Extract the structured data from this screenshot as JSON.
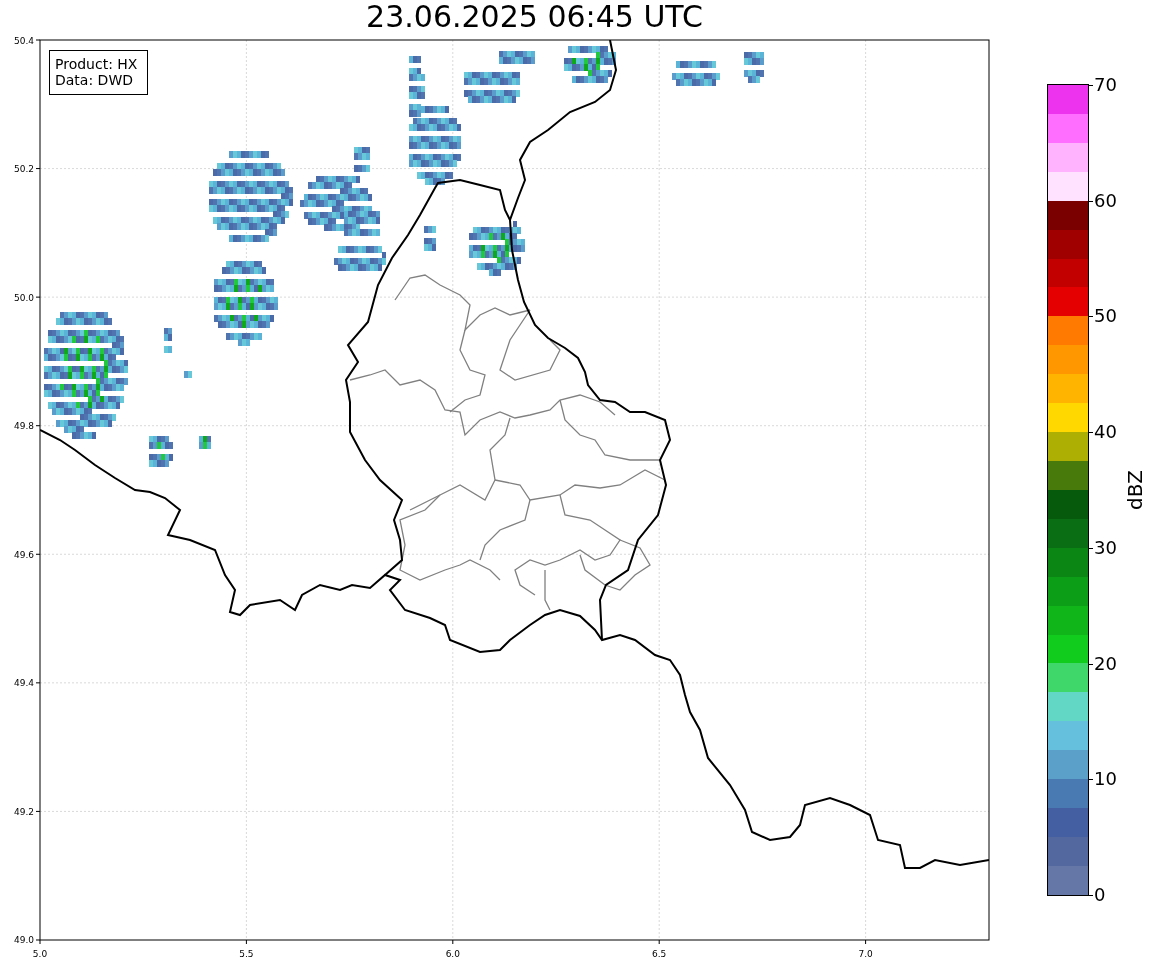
{
  "title": "23.06.2025 06:45 UTC",
  "map": {
    "info_box": [
      "Product: HX",
      "Data: DWD"
    ],
    "x_ticks": [
      "5.0",
      "5.5",
      "6.0",
      "6.5",
      "7.0"
    ],
    "y_ticks": [
      "50.4",
      "50.2",
      "50.0",
      "49.8",
      "49.6",
      "49.4",
      "49.2",
      "49.0"
    ]
  },
  "colorbar": {
    "label": "dBZ",
    "ticks": [
      "70",
      "60",
      "50",
      "40",
      "30",
      "20",
      "10",
      "0"
    ],
    "segments": [
      {
        "color": "#ee33ee"
      },
      {
        "color": "#ff6eff"
      },
      {
        "color": "#ffb3ff"
      },
      {
        "color": "#ffe2ff"
      },
      {
        "color": "#7a0000"
      },
      {
        "color": "#a00000"
      },
      {
        "color": "#c20000"
      },
      {
        "color": "#e40000"
      },
      {
        "color": "#ff7a00"
      },
      {
        "color": "#ff9700"
      },
      {
        "color": "#ffb400"
      },
      {
        "color": "#ffd800"
      },
      {
        "color": "#adb003"
      },
      {
        "color": "#477a0a"
      },
      {
        "color": "#065a0c"
      },
      {
        "color": "#0a6e14"
      },
      {
        "color": "#0b8615"
      },
      {
        "color": "#0c9e17"
      },
      {
        "color": "#10b619"
      },
      {
        "color": "#12cc1d"
      },
      {
        "color": "#3fd66a"
      },
      {
        "color": "#62d7c6"
      },
      {
        "color": "#64c0dc"
      },
      {
        "color": "#5aa0c8"
      },
      {
        "color": "#4a7ab2"
      },
      {
        "color": "#4560a2"
      },
      {
        "color": "#52689f"
      },
      {
        "color": "#6477a7"
      }
    ]
  }
}
